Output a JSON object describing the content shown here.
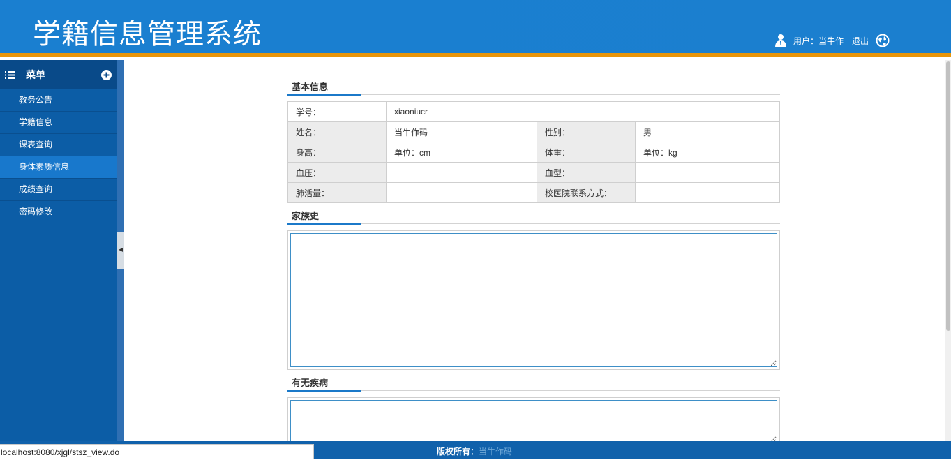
{
  "header": {
    "title": "学籍信息管理系统",
    "user_text": "用户：当牛作",
    "logout_label": "退出"
  },
  "sidebar": {
    "menu_label": "菜单",
    "items": [
      {
        "label": "教务公告"
      },
      {
        "label": "学籍信息"
      },
      {
        "label": "课表查询"
      },
      {
        "label": "身体素质信息",
        "active": true
      },
      {
        "label": "成绩查询"
      },
      {
        "label": "密码修改"
      }
    ]
  },
  "basic": {
    "section_title": "基本信息",
    "student_id_label": "学号：",
    "student_id_value": "xiaoniucr",
    "name_label": "姓名：",
    "name_value": "当牛作码",
    "gender_label": "性别：",
    "gender_value": "男",
    "height_label": "身高：",
    "height_value": "单位：cm",
    "weight_label": "体重：",
    "weight_value": "单位：kg",
    "bp_label": "血压：",
    "bp_value": "",
    "blood_type_label": "血型：",
    "blood_type_value": "",
    "lung_label": "肺活量：",
    "lung_value": "",
    "clinic_label": "校医院联系方式：",
    "clinic_value": ""
  },
  "family": {
    "section_title": "家族史",
    "value": ""
  },
  "disease": {
    "section_title": "有无疾病",
    "value": ""
  },
  "footer": {
    "copyright_label": "版权所有：",
    "owner": "当牛作码"
  },
  "status_url": "localhost:8080/xjgl/stsz_view.do",
  "colors": {
    "header": "#1a7fd0",
    "accent": "#e8950a",
    "sidebar": "#0c5da6",
    "active": "#1878cc"
  }
}
